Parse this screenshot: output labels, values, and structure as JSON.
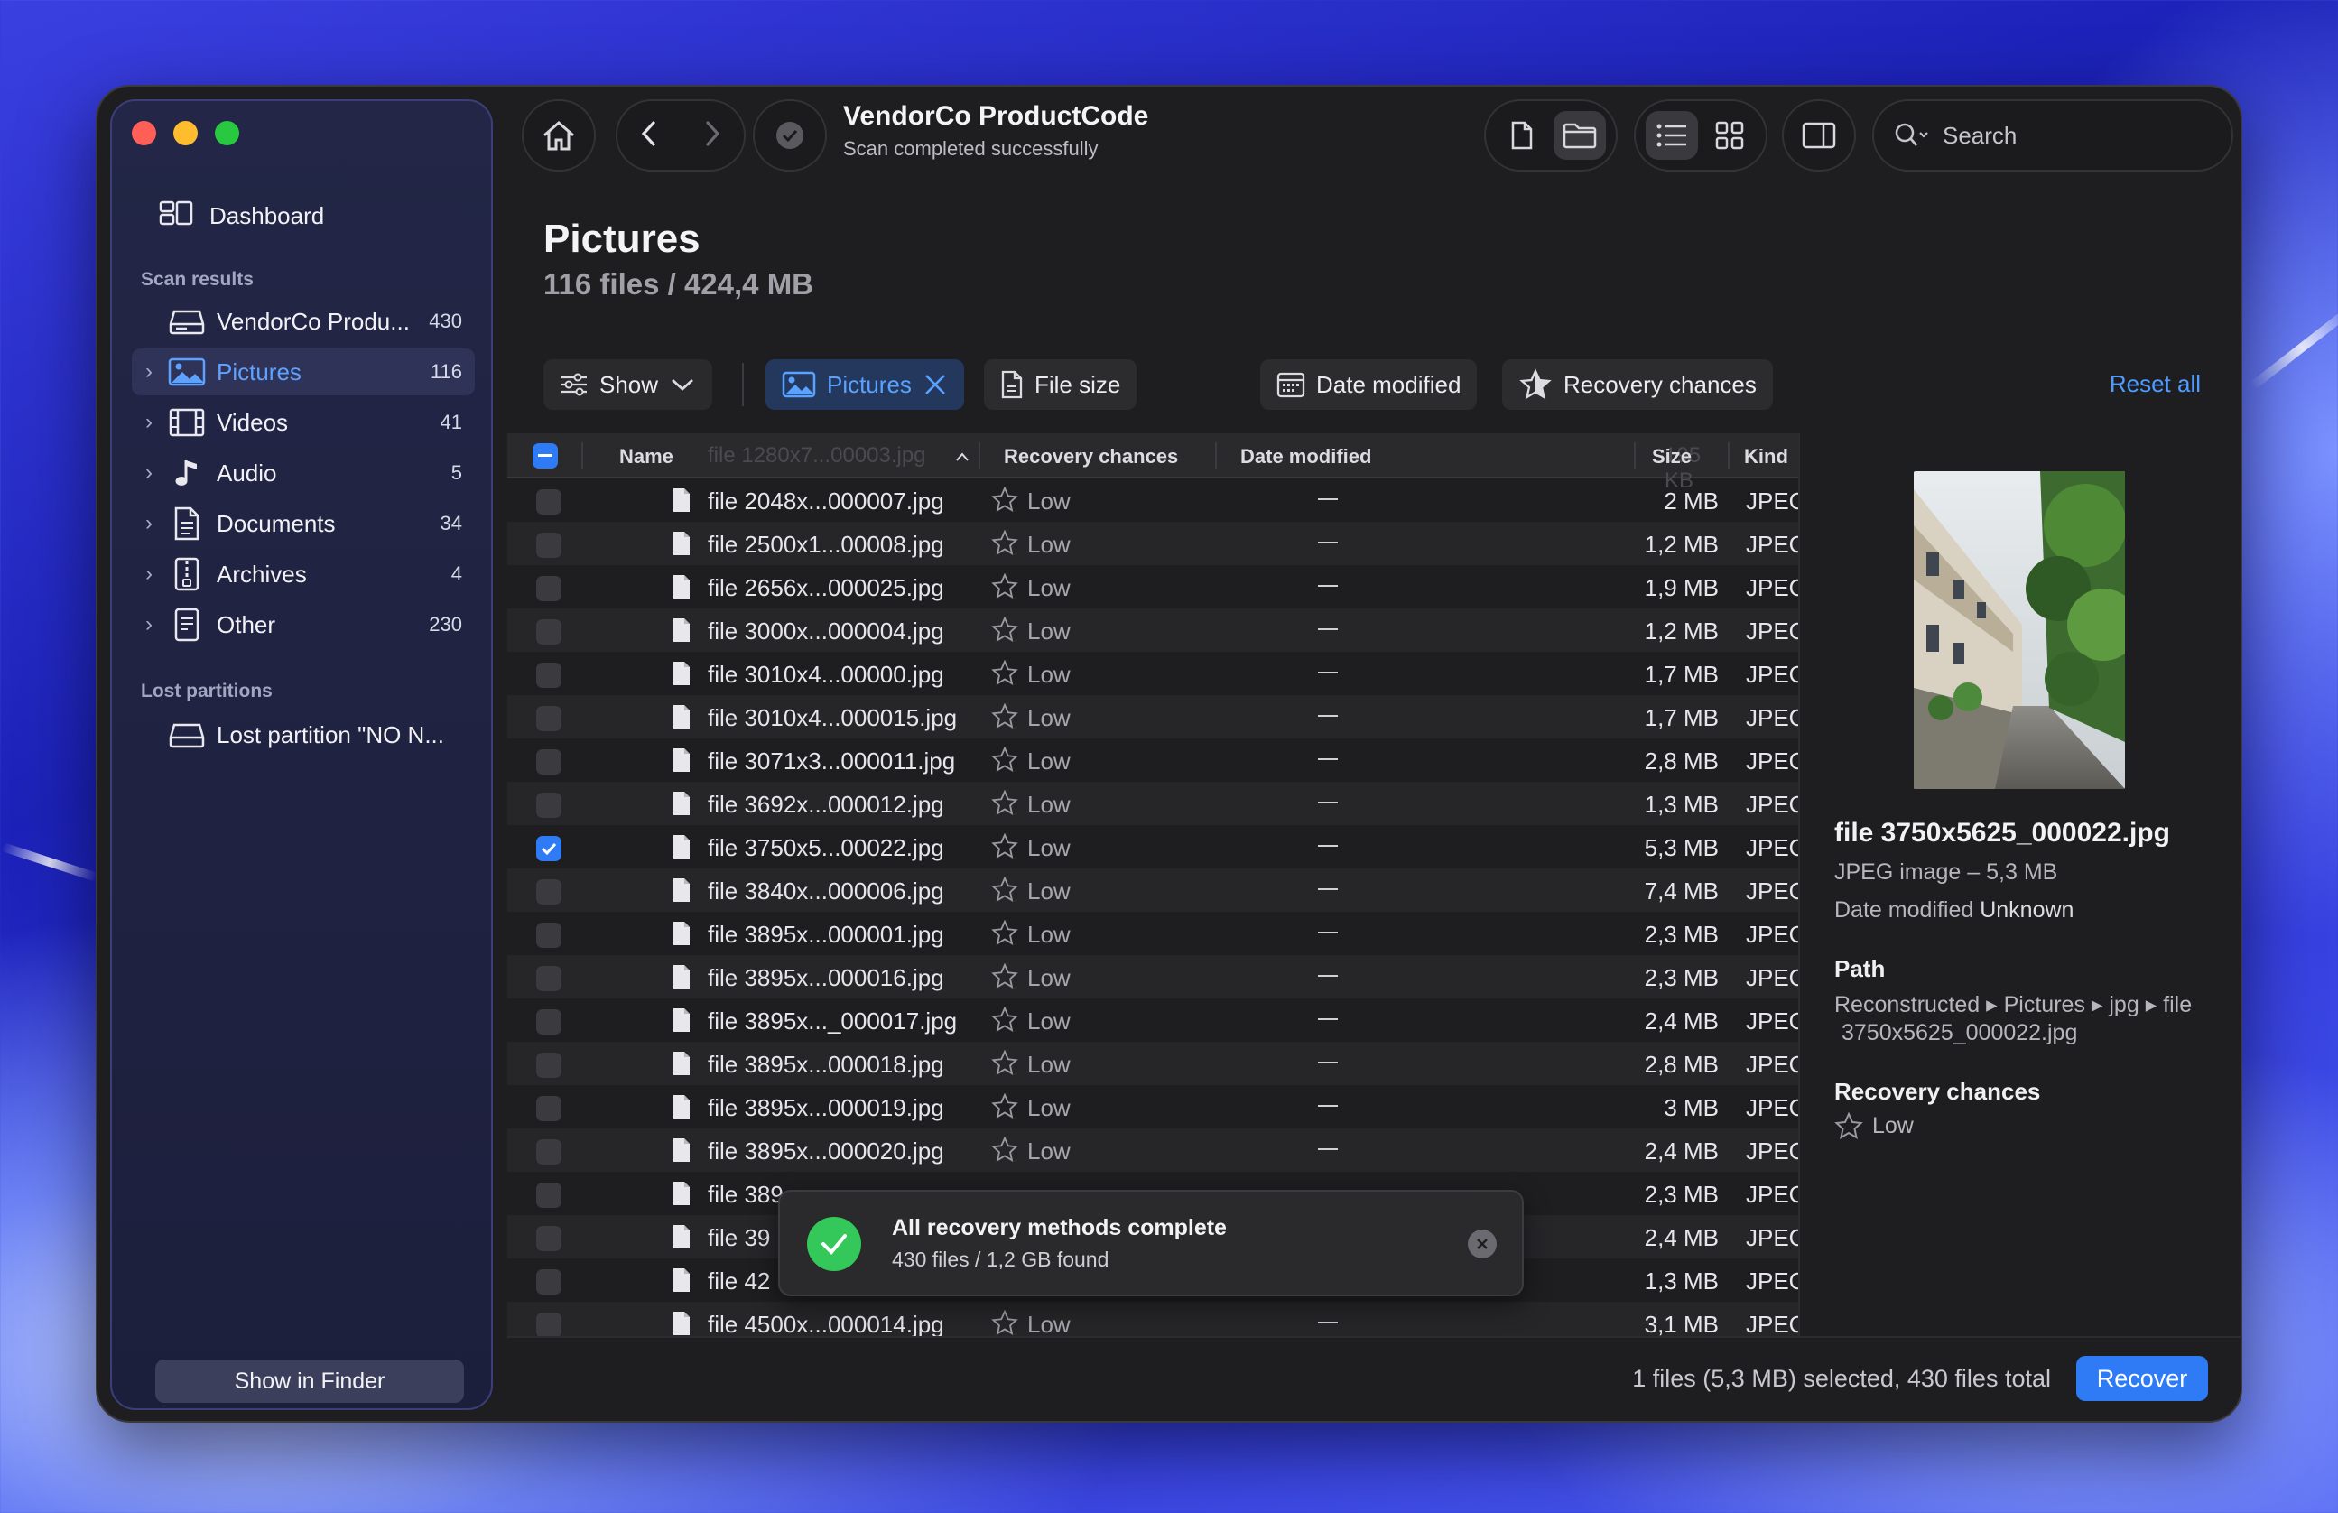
{
  "window": {
    "title": "VendorCo ProductCode",
    "subtitle": "Scan completed successfully",
    "search_placeholder": "Search"
  },
  "sidebar": {
    "dashboard_label": "Dashboard",
    "scan_results_heading": "Scan results",
    "scan_items": [
      {
        "label": "VendorCo Produ...",
        "count": "430",
        "icon": "drive-icon"
      },
      {
        "label": "Pictures",
        "count": "116",
        "icon": "image-icon",
        "active": true
      },
      {
        "label": "Videos",
        "count": "41",
        "icon": "film-icon"
      },
      {
        "label": "Audio",
        "count": "5",
        "icon": "music-note-icon"
      },
      {
        "label": "Documents",
        "count": "34",
        "icon": "document-icon"
      },
      {
        "label": "Archives",
        "count": "4",
        "icon": "archive-icon"
      },
      {
        "label": "Other",
        "count": "230",
        "icon": "other-file-icon"
      }
    ],
    "lost_partitions_heading": "Lost partitions",
    "lost_partition_label": "Lost partition \"NO N...",
    "show_in_finder": "Show in Finder"
  },
  "main": {
    "title": "Pictures",
    "subtitle": "116 files / 424,4 MB",
    "filters": {
      "show": "Show",
      "pictures": "Pictures",
      "file_size": "File size",
      "date_modified": "Date modified",
      "recovery_chances": "Recovery chances",
      "reset_all": "Reset all"
    },
    "table": {
      "headers": {
        "name": "Name",
        "recovery": "Recovery chances",
        "date": "Date modified",
        "size": "Size",
        "kind": "Kind"
      },
      "ghost_name": "file 1280x7...00003.jpg",
      "ghost_size": "195 KB",
      "rows": [
        {
          "name": "file 2048x...000007.jpg",
          "recovery": "Low",
          "date": "—",
          "size": "2 MB",
          "kind": "JPEG",
          "checked": false
        },
        {
          "name": "file 2500x1...00008.jpg",
          "recovery": "Low",
          "date": "—",
          "size": "1,2 MB",
          "kind": "JPEG",
          "checked": false
        },
        {
          "name": "file 2656x...000025.jpg",
          "recovery": "Low",
          "date": "—",
          "size": "1,9 MB",
          "kind": "JPEG",
          "checked": false
        },
        {
          "name": "file 3000x...000004.jpg",
          "recovery": "Low",
          "date": "—",
          "size": "1,2 MB",
          "kind": "JPEG",
          "checked": false
        },
        {
          "name": "file 3010x4...00000.jpg",
          "recovery": "Low",
          "date": "—",
          "size": "1,7 MB",
          "kind": "JPEG",
          "checked": false
        },
        {
          "name": "file 3010x4...000015.jpg",
          "recovery": "Low",
          "date": "—",
          "size": "1,7 MB",
          "kind": "JPEG",
          "checked": false
        },
        {
          "name": "file 3071x3...000011.jpg",
          "recovery": "Low",
          "date": "—",
          "size": "2,8 MB",
          "kind": "JPEG",
          "checked": false
        },
        {
          "name": "file 3692x...000012.jpg",
          "recovery": "Low",
          "date": "—",
          "size": "1,3 MB",
          "kind": "JPEG",
          "checked": false
        },
        {
          "name": "file 3750x5...00022.jpg",
          "recovery": "Low",
          "date": "—",
          "size": "5,3 MB",
          "kind": "JPEG",
          "checked": true
        },
        {
          "name": "file 3840x...000006.jpg",
          "recovery": "Low",
          "date": "—",
          "size": "7,4 MB",
          "kind": "JPEG",
          "checked": false
        },
        {
          "name": "file 3895x...000001.jpg",
          "recovery": "Low",
          "date": "—",
          "size": "2,3 MB",
          "kind": "JPEG",
          "checked": false
        },
        {
          "name": "file 3895x...000016.jpg",
          "recovery": "Low",
          "date": "—",
          "size": "2,3 MB",
          "kind": "JPEG",
          "checked": false
        },
        {
          "name": "file 3895x..._000017.jpg",
          "recovery": "Low",
          "date": "—",
          "size": "2,4 MB",
          "kind": "JPEG",
          "checked": false
        },
        {
          "name": "file 3895x...000018.jpg",
          "recovery": "Low",
          "date": "—",
          "size": "2,8 MB",
          "kind": "JPEG",
          "checked": false
        },
        {
          "name": "file 3895x...000019.jpg",
          "recovery": "Low",
          "date": "—",
          "size": "3 MB",
          "kind": "JPEG",
          "checked": false
        },
        {
          "name": "file 3895x...000020.jpg",
          "recovery": "Low",
          "date": "—",
          "size": "2,4 MB",
          "kind": "JPEG",
          "checked": false
        },
        {
          "name": "file 389",
          "recovery": "",
          "date": "",
          "size": "2,3 MB",
          "kind": "JPEG",
          "checked": false
        },
        {
          "name": "file 39",
          "recovery": "",
          "date": "",
          "size": "2,4 MB",
          "kind": "JPEG",
          "checked": false
        },
        {
          "name": "file 42",
          "recovery": "",
          "date": "",
          "size": "1,3 MB",
          "kind": "JPEG",
          "checked": false
        },
        {
          "name": "file 4500x...000014.jpg",
          "recovery": "Low",
          "date": "—",
          "size": "3,1 MB",
          "kind": "JPEG",
          "checked": false
        }
      ]
    }
  },
  "details": {
    "file_name": "file 3750x5625_000022.jpg",
    "kind_size": "JPEG image – 5,3 MB",
    "date_modified_label": "Date modified",
    "date_modified_value": "Unknown",
    "path_heading": "Path",
    "path_line1": "Reconstructed ▸ Pictures ▸ jpg ▸ file",
    "path_line2": "3750x5625_000022.jpg",
    "recovery_heading": "Recovery chances",
    "recovery_value": "Low"
  },
  "footer": {
    "status": "1 files (5,3 MB) selected, 430 files total",
    "recover_button": "Recover"
  },
  "toast": {
    "title": "All recovery methods complete",
    "subtitle": "430 files / 1,2 GB found"
  },
  "colors": {
    "accent": "#2f7bf5",
    "link": "#4f9bff",
    "success": "#34c759",
    "window_bg": "#1e1e20",
    "sidebar_bg": "#1f2240"
  }
}
